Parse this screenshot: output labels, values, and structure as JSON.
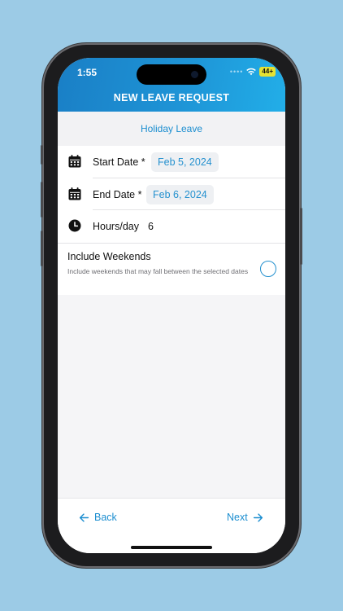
{
  "status_bar": {
    "time": "1:55",
    "battery": "44+"
  },
  "header": {
    "title": "NEW LEAVE REQUEST"
  },
  "leave_type": "Holiday Leave",
  "form": {
    "start_date": {
      "label": "Start Date *",
      "value": "Feb 5, 2024"
    },
    "end_date": {
      "label": "End Date *",
      "value": "Feb 6, 2024"
    },
    "hours": {
      "label": "Hours/day",
      "value": "6"
    },
    "weekends": {
      "title": "Include Weekends",
      "description": "Include weekends that may fall between the selected dates",
      "checked": false
    }
  },
  "footer": {
    "back_label": "Back",
    "next_label": "Next"
  },
  "colors": {
    "accent": "#1c8ed0",
    "header_start": "#1a7fc6",
    "header_end": "#22aee8",
    "background": "#9ccbe6"
  },
  "icons": [
    "calendar-icon",
    "clock-icon",
    "arrow-left-icon",
    "arrow-right-icon",
    "wifi-icon"
  ]
}
